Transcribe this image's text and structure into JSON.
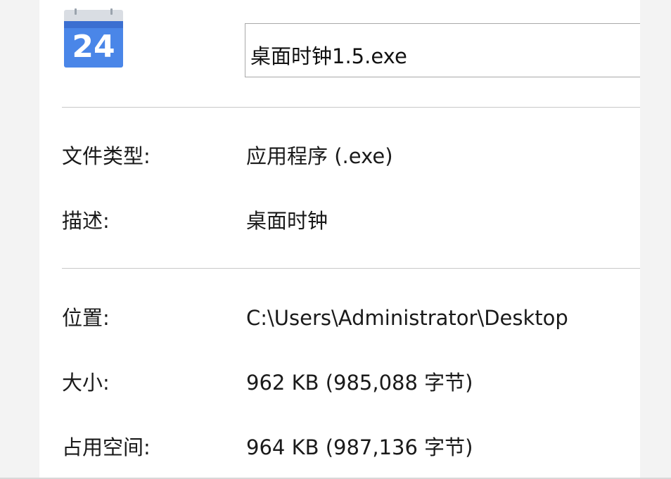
{
  "file": {
    "icon": "calendar-24-icon",
    "icon_text": "24",
    "name": "桌面时钟1.5.exe"
  },
  "properties": {
    "file_type_label": "文件类型:",
    "file_type_value": "应用程序 (.exe)",
    "description_label": "描述:",
    "description_value": "桌面时钟",
    "location_label": "位置:",
    "location_value": "C:\\Users\\Administrator\\Desktop",
    "size_label": "大小:",
    "size_value": "962 KB (985,088 字节)",
    "size_on_disk_label": "占用空间:",
    "size_on_disk_value": "964 KB (987,136 字节)"
  },
  "colors": {
    "icon_blue": "#4a86e8",
    "icon_blue_dark": "#3b6fd1",
    "icon_top": "#d9dde3"
  }
}
